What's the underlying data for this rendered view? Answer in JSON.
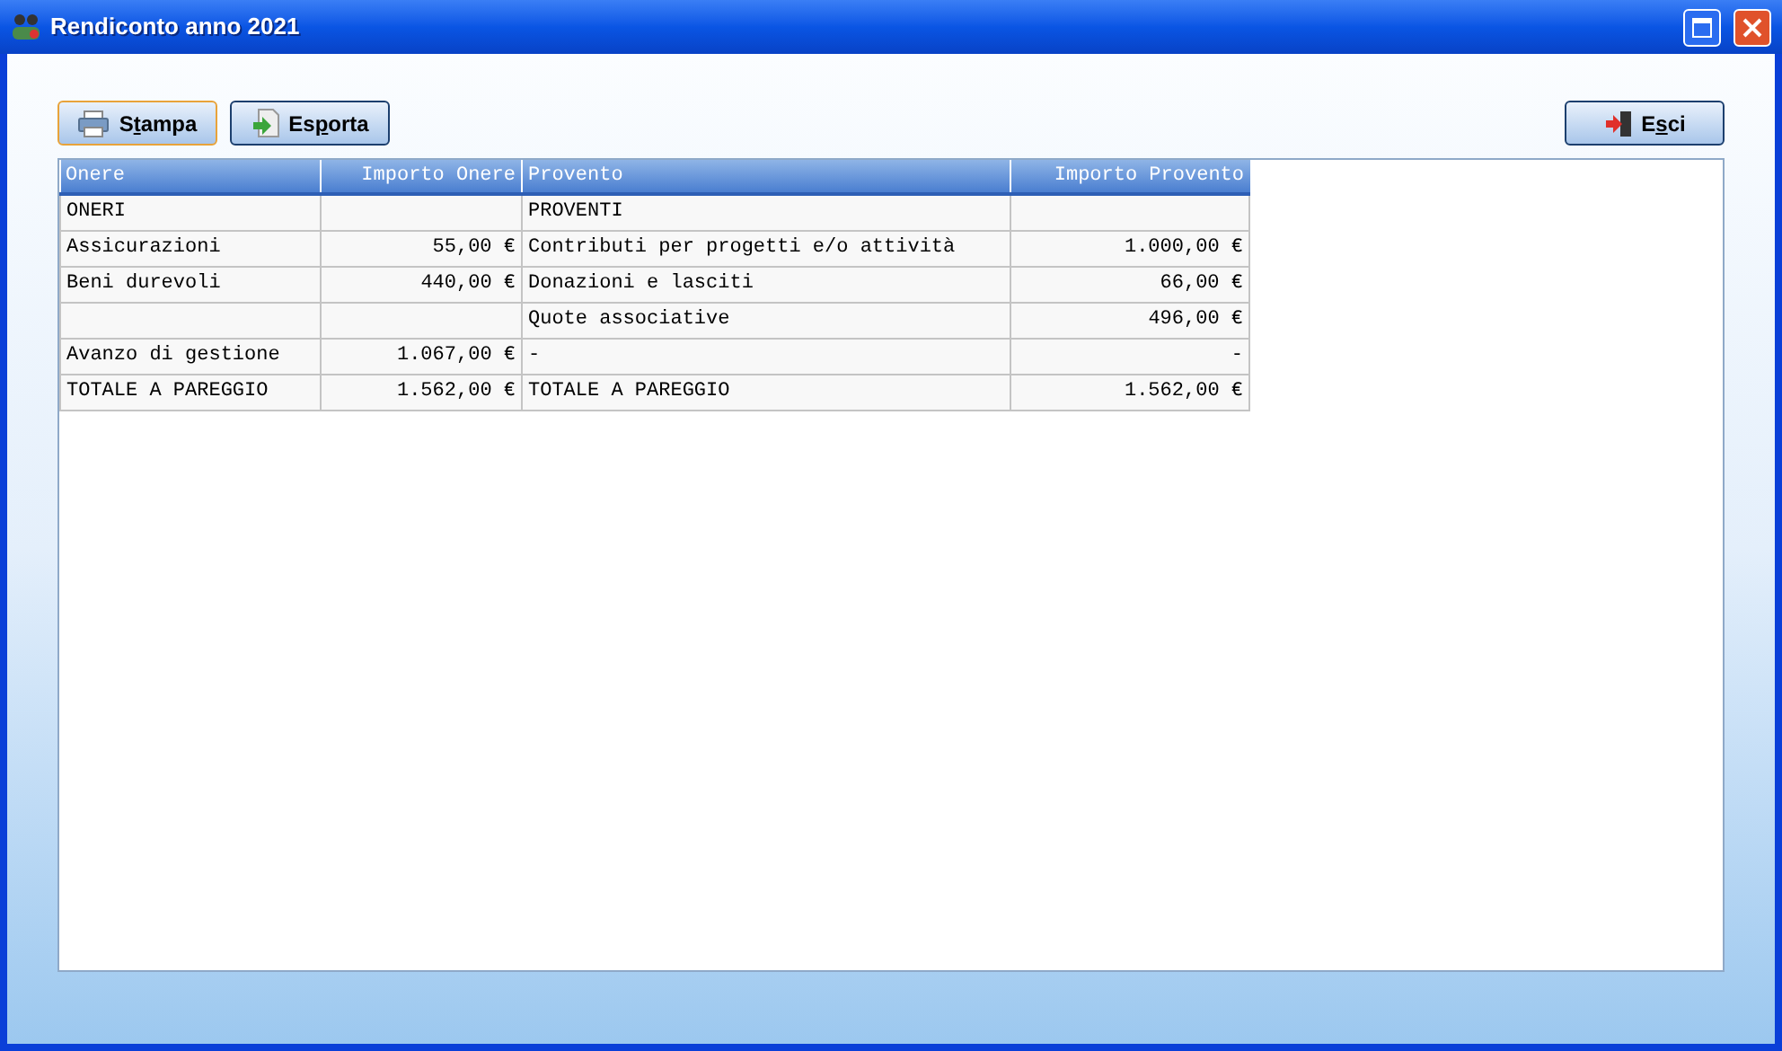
{
  "window": {
    "title": "Rendiconto anno 2021"
  },
  "toolbar": [
    {
      "before": "S",
      "accel": "t",
      "after": "ampa",
      "kind": "print",
      "focused": true
    },
    {
      "before": "Es",
      "accel": "p",
      "after": "orta",
      "kind": "export",
      "focused": false
    }
  ],
  "exit_button": {
    "before": "E",
    "accel": "s",
    "after": "ci"
  },
  "table": {
    "columns": [
      "Onere",
      "Importo Onere",
      "Provento",
      "Importo Provento"
    ],
    "rows": [
      [
        "ONERI",
        "",
        "PROVENTI",
        ""
      ],
      [
        "Assicurazioni",
        "55,00 €",
        "Contributi per progetti e/o attività",
        "1.000,00 €"
      ],
      [
        "Beni durevoli",
        "440,00 €",
        "Donazioni e lasciti",
        "66,00 €"
      ],
      [
        "",
        "",
        "Quote associative",
        "496,00 €"
      ],
      [
        "Avanzo di gestione",
        "1.067,00 €",
        "-",
        "-"
      ],
      [
        "TOTALE A PAREGGIO",
        "1.562,00 €",
        "TOTALE A PAREGGIO",
        "1.562,00 €"
      ]
    ]
  }
}
